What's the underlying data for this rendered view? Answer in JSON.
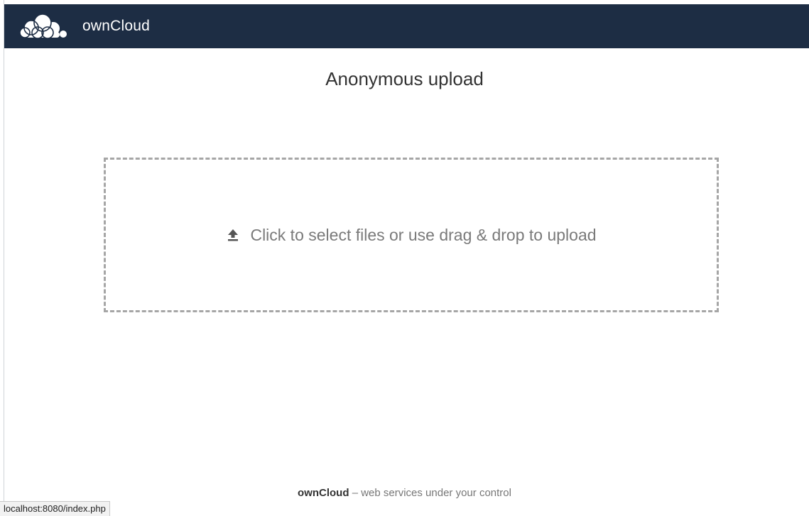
{
  "header": {
    "brand": "ownCloud",
    "logo_icon": "owncloud-cloud-logo-icon",
    "background_color": "#1d2d44"
  },
  "main": {
    "title": "Anonymous upload",
    "dropzone": {
      "icon": "upload-arrow-icon",
      "text": "Click to select files or use drag & drop to upload"
    }
  },
  "footer": {
    "brand": "ownCloud",
    "tagline": "– web services under your control"
  },
  "status_bar": {
    "url": "localhost:8080/index.php"
  }
}
